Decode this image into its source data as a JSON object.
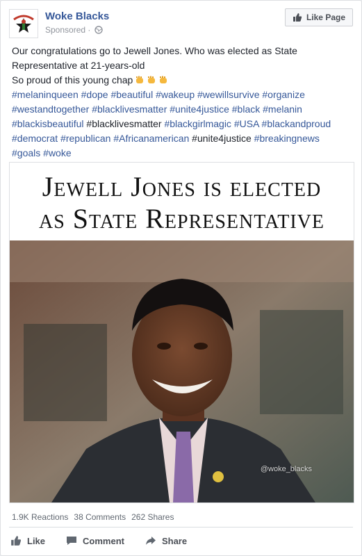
{
  "page": {
    "name": "Woke Blacks",
    "sponsored": "Sponsored ·",
    "like_page_label": "Like Page",
    "avatar_icon": "woke-blacks-logo",
    "colors": {
      "link": "#365899",
      "text": "#1d2129",
      "muted": "#90949c"
    }
  },
  "post": {
    "text_lines": [
      "Our congratulations go to Jewell Jones. Who was elected as State",
      "Representative at 21-years-old",
      "So proud of this young chap"
    ],
    "emoji_icon": "raised-fist-emoji",
    "hashtag_lines": [
      [
        {
          "t": "#melaninqueen",
          "link": true
        },
        {
          "t": " ",
          "link": false
        },
        {
          "t": "#dope",
          "link": true
        },
        {
          "t": " ",
          "link": false
        },
        {
          "t": "#beautiful",
          "link": true
        },
        {
          "t": " ",
          "link": false
        },
        {
          "t": "#wakeup",
          "link": true
        },
        {
          "t": " ",
          "link": false
        },
        {
          "t": "#wewillsurvive",
          "link": true
        },
        {
          "t": " ",
          "link": false
        },
        {
          "t": "#organize",
          "link": true
        }
      ],
      [
        {
          "t": "#westandtogether",
          "link": true
        },
        {
          "t": " ",
          "link": false
        },
        {
          "t": "#blacklivesmatter",
          "link": true
        },
        {
          "t": " ",
          "link": false
        },
        {
          "t": "#unite4justice",
          "link": true
        },
        {
          "t": " ",
          "link": false
        },
        {
          "t": "#black",
          "link": true
        },
        {
          "t": " ",
          "link": false
        },
        {
          "t": "#melanin",
          "link": true
        }
      ],
      [
        {
          "t": "#blackisbeautiful",
          "link": true
        },
        {
          "t": " #blacklivesmatter ",
          "link": false
        },
        {
          "t": "#blackgirlmagic",
          "link": true
        },
        {
          "t": " ",
          "link": false
        },
        {
          "t": "#USA",
          "link": true
        },
        {
          "t": " ",
          "link": false
        },
        {
          "t": "#blackandproud",
          "link": true
        }
      ],
      [
        {
          "t": "#democrat",
          "link": true
        },
        {
          "t": " ",
          "link": false
        },
        {
          "t": "#republican",
          "link": true
        },
        {
          "t": " ",
          "link": false
        },
        {
          "t": "#Africanamerican",
          "link": true
        },
        {
          "t": " #unite4justice ",
          "link": false
        },
        {
          "t": "#breakingnews",
          "link": true
        }
      ],
      [
        {
          "t": "#goals",
          "link": true
        },
        {
          "t": " ",
          "link": false
        },
        {
          "t": "#woke",
          "link": true
        }
      ]
    ]
  },
  "image": {
    "headline_line1": "Jewell Jones is elected",
    "headline_line2": "as State Representative",
    "watermark": "@woke_blacks"
  },
  "stats": {
    "reactions": "1.9K Reactions",
    "comments": "38 Comments",
    "shares": "262 Shares"
  },
  "actions": {
    "like": "Like",
    "comment": "Comment",
    "share": "Share"
  }
}
